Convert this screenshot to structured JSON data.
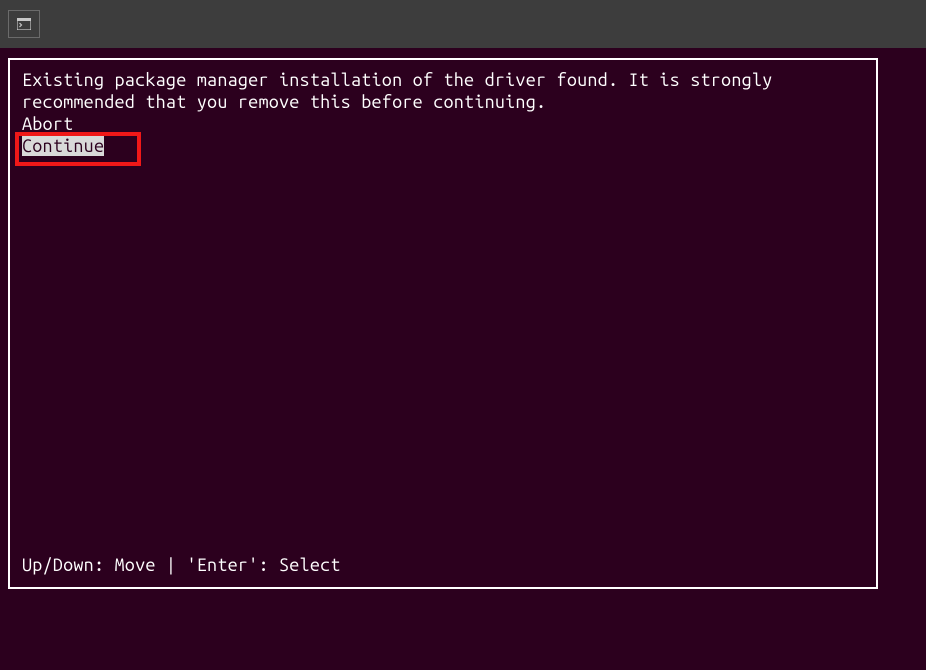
{
  "titlebar": {
    "icon_name": "terminal-icon"
  },
  "dialog": {
    "message": "Existing package manager installation of the driver found. It is strongly recommended that you remove this before continuing.",
    "options": [
      {
        "label": "Abort",
        "selected": false
      },
      {
        "label": "Continue",
        "selected": true
      }
    ],
    "footer": "Up/Down: Move | 'Enter': Select"
  },
  "highlight": {
    "target": "option-continue"
  },
  "colors": {
    "background": "#2c001e",
    "border": "#ffffff",
    "text": "#ffffff",
    "highlight_box": "#f01818",
    "selected_bg": "#d9d9d9",
    "selected_fg": "#2c001e",
    "titlebar_bg": "#3d3d3d"
  }
}
